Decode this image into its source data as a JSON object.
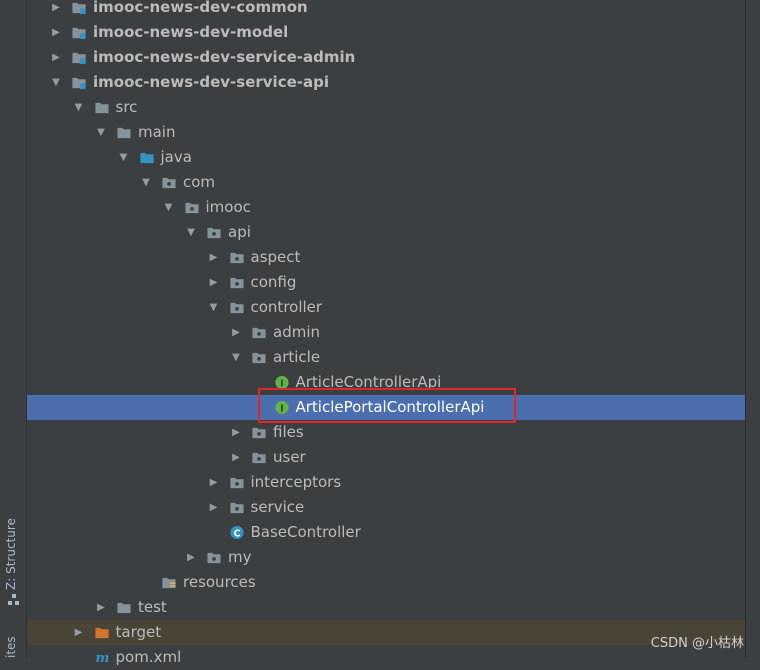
{
  "sidebar": {
    "structure_label": "Z: Structure",
    "favorites_label": "ites"
  },
  "tree": {
    "rows": [
      {
        "label": "imooc-news-dev-common",
        "icon": "module-folder-icon",
        "expanded": false,
        "bold": true
      },
      {
        "label": "imooc-news-dev-model",
        "icon": "module-folder-icon",
        "expanded": false,
        "bold": true
      },
      {
        "label": "imooc-news-dev-service-admin",
        "icon": "module-folder-icon",
        "expanded": false,
        "bold": true
      },
      {
        "label": "imooc-news-dev-service-api",
        "icon": "module-folder-icon",
        "expanded": true,
        "bold": true
      },
      {
        "label": "src",
        "icon": "folder-icon",
        "expanded": true
      },
      {
        "label": "main",
        "icon": "folder-icon",
        "expanded": true
      },
      {
        "label": "java",
        "icon": "source-folder-icon",
        "expanded": true
      },
      {
        "label": "com",
        "icon": "package-icon",
        "expanded": true
      },
      {
        "label": "imooc",
        "icon": "package-icon",
        "expanded": true
      },
      {
        "label": "api",
        "icon": "package-icon",
        "expanded": true
      },
      {
        "label": "aspect",
        "icon": "package-icon",
        "expanded": false
      },
      {
        "label": "config",
        "icon": "package-icon",
        "expanded": false
      },
      {
        "label": "controller",
        "icon": "package-icon",
        "expanded": true
      },
      {
        "label": "admin",
        "icon": "package-icon",
        "expanded": false
      },
      {
        "label": "article",
        "icon": "package-icon",
        "expanded": true
      },
      {
        "label": "ArticleControllerApi",
        "icon": "interface-icon"
      },
      {
        "label": "ArticlePortalControllerApi",
        "icon": "interface-icon",
        "selected": true
      },
      {
        "label": "files",
        "icon": "package-icon",
        "expanded": false
      },
      {
        "label": "user",
        "icon": "package-icon",
        "expanded": false
      },
      {
        "label": "interceptors",
        "icon": "package-icon",
        "expanded": false
      },
      {
        "label": "service",
        "icon": "package-icon",
        "expanded": false
      },
      {
        "label": "BaseController",
        "icon": "class-icon"
      },
      {
        "label": "my",
        "icon": "package-icon",
        "expanded": false
      },
      {
        "label": "resources",
        "icon": "resources-folder-icon"
      },
      {
        "label": "test",
        "icon": "folder-icon",
        "expanded": false
      },
      {
        "label": "target",
        "icon": "excluded-folder-icon",
        "expanded": false,
        "excluded": true
      },
      {
        "label": "pom.xml",
        "icon": "maven-icon"
      }
    ]
  },
  "colors": {
    "background": "#3c3f41",
    "selection": "#4b6eaf",
    "excluded": "#4a4436",
    "highlight_box": "#e0262b"
  },
  "watermark": "CSDN @小枯林"
}
